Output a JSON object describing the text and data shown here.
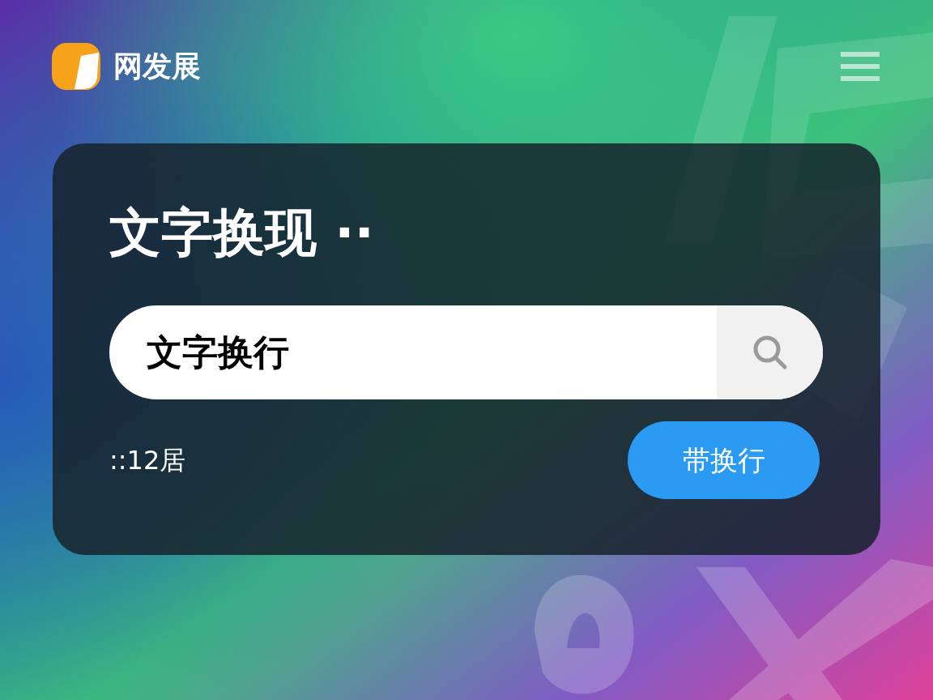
{
  "header": {
    "brand": "网发展"
  },
  "card": {
    "title": "文字换现 ··",
    "search": {
      "value": "文字换行"
    },
    "count": "::12居",
    "button": "带换行"
  }
}
